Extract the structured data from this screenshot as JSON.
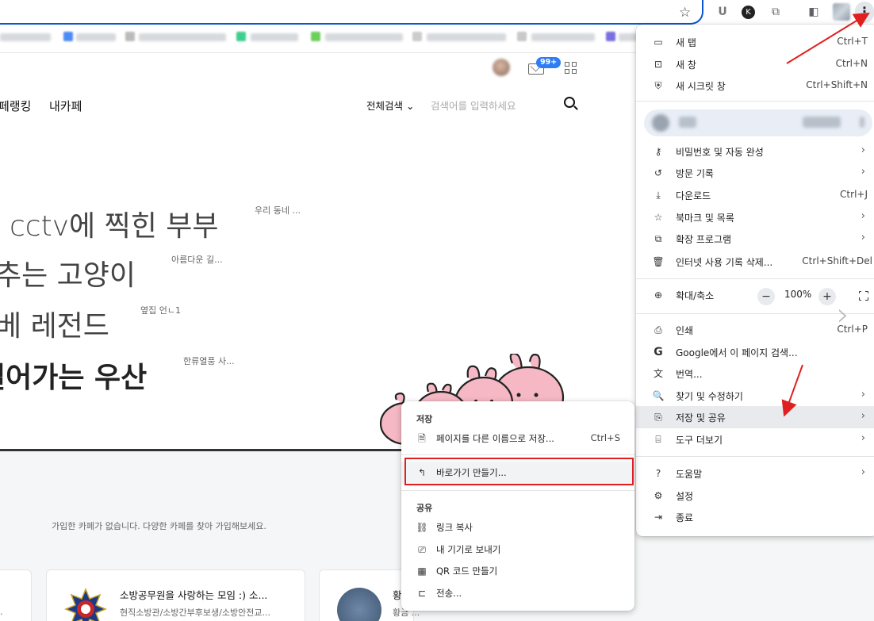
{
  "toolbar": {
    "extensions": [
      "U",
      "K"
    ]
  },
  "page": {
    "nav": [
      "페랭킹",
      "내카페"
    ],
    "search_scope": "전체검색",
    "search_placeholder": "검색어를 입력하세요",
    "mail_badge": "99+",
    "hero": [
      {
        "text": "cctv에 찍힌 부부",
        "tag": "우리 동네 ..."
      },
      {
        "text": "추는 고양이",
        "tag": "아름다운 길..."
      },
      {
        "text": "베 레전드",
        "tag": "옆집 언ㄴ1"
      },
      {
        "text": "걸어가는 우산",
        "tag": "한류열풍 사..."
      }
    ],
    "empty_message": "가입한 카페가 없습니다. 다양한 카페를 찾아 가입해보세요.",
    "cards": [
      {
        "title": "",
        "subtitle": "...",
        "ellipsis": "..."
      },
      {
        "title": "소방공무원을 사랑하는 모임 :) 소...",
        "subtitle": "현직소방관/소방간부후보생/소방안전교..."
      },
      {
        "title": "황",
        "subtitle": "황금 ..."
      }
    ]
  },
  "menu": {
    "items": [
      {
        "icon": "new-tab-icon",
        "label": "새 탭",
        "shortcut": "Ctrl+T"
      },
      {
        "icon": "new-window-icon",
        "label": "새 창",
        "shortcut": "Ctrl+N"
      },
      {
        "icon": "incognito-icon",
        "label": "새 시크릿 창",
        "shortcut": "Ctrl+Shift+N"
      },
      {
        "icon": "key-icon",
        "label": "비밀번호 및 자동 완성",
        "shortcut": ""
      },
      {
        "icon": "history-icon",
        "label": "방문 기록",
        "shortcut": ""
      },
      {
        "icon": "download-icon",
        "label": "다운로드",
        "shortcut": "Ctrl+J"
      },
      {
        "icon": "bookmark-star-icon",
        "label": "북마크 및 목록",
        "shortcut": ""
      },
      {
        "icon": "extensions-icon",
        "label": "확장 프로그램",
        "shortcut": ""
      },
      {
        "icon": "trash-icon",
        "label": "인터넷 사용 기록 삭제...",
        "shortcut": "Ctrl+Shift+Del"
      },
      {
        "icon": "print-icon",
        "label": "인쇄",
        "shortcut": "Ctrl+P"
      },
      {
        "icon": "google-icon",
        "label": "Google에서 이 페이지 검색...",
        "shortcut": ""
      },
      {
        "icon": "translate-icon",
        "label": "번역...",
        "shortcut": ""
      },
      {
        "icon": "find-icon",
        "label": "찾기 및 수정하기",
        "shortcut": ""
      },
      {
        "icon": "save-share-icon",
        "label": "저장 및 공유",
        "shortcut": ""
      },
      {
        "icon": "toolbox-icon",
        "label": "도구 더보기",
        "shortcut": ""
      },
      {
        "icon": "help-icon",
        "label": "도움말",
        "shortcut": ""
      },
      {
        "icon": "settings-icon",
        "label": "설정",
        "shortcut": ""
      },
      {
        "icon": "exit-icon",
        "label": "종료",
        "shortcut": ""
      }
    ],
    "zoom": {
      "label": "확대/축소",
      "minus": "−",
      "value": "100%",
      "plus": "+"
    }
  },
  "submenu": {
    "save_header": "저장",
    "save_items": [
      {
        "label": "페이지를 다른 이름으로 저장...",
        "shortcut": "Ctrl+S"
      },
      {
        "label": "바로가기 만들기...",
        "shortcut": ""
      }
    ],
    "share_header": "공유",
    "share_items": [
      {
        "label": "링크 복사"
      },
      {
        "label": "내 기기로 보내기"
      },
      {
        "label": "QR 코드 만들기"
      },
      {
        "label": "전송..."
      }
    ]
  },
  "colors": {
    "accent": "#0b57d0",
    "annotation": "#e02020",
    "badge": "#2f7df6",
    "bunny_pink": "#f5b8c4"
  }
}
